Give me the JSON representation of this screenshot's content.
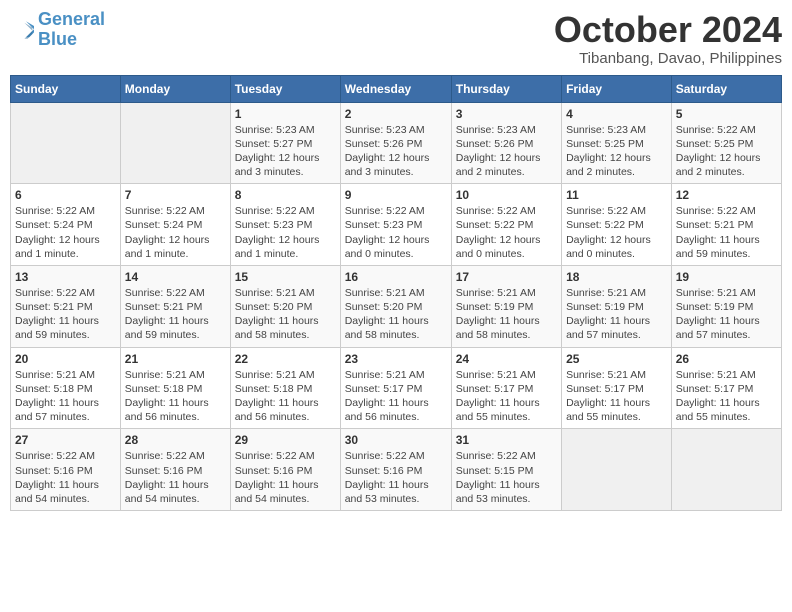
{
  "logo": {
    "line1": "General",
    "line2": "Blue"
  },
  "title": "October 2024",
  "subtitle": "Tibanbang, Davao, Philippines",
  "weekdays": [
    "Sunday",
    "Monday",
    "Tuesday",
    "Wednesday",
    "Thursday",
    "Friday",
    "Saturday"
  ],
  "weeks": [
    [
      {
        "day": "",
        "info": ""
      },
      {
        "day": "",
        "info": ""
      },
      {
        "day": "1",
        "info": "Sunrise: 5:23 AM\nSunset: 5:27 PM\nDaylight: 12 hours\nand 3 minutes."
      },
      {
        "day": "2",
        "info": "Sunrise: 5:23 AM\nSunset: 5:26 PM\nDaylight: 12 hours\nand 3 minutes."
      },
      {
        "day": "3",
        "info": "Sunrise: 5:23 AM\nSunset: 5:26 PM\nDaylight: 12 hours\nand 2 minutes."
      },
      {
        "day": "4",
        "info": "Sunrise: 5:23 AM\nSunset: 5:25 PM\nDaylight: 12 hours\nand 2 minutes."
      },
      {
        "day": "5",
        "info": "Sunrise: 5:22 AM\nSunset: 5:25 PM\nDaylight: 12 hours\nand 2 minutes."
      }
    ],
    [
      {
        "day": "6",
        "info": "Sunrise: 5:22 AM\nSunset: 5:24 PM\nDaylight: 12 hours\nand 1 minute."
      },
      {
        "day": "7",
        "info": "Sunrise: 5:22 AM\nSunset: 5:24 PM\nDaylight: 12 hours\nand 1 minute."
      },
      {
        "day": "8",
        "info": "Sunrise: 5:22 AM\nSunset: 5:23 PM\nDaylight: 12 hours\nand 1 minute."
      },
      {
        "day": "9",
        "info": "Sunrise: 5:22 AM\nSunset: 5:23 PM\nDaylight: 12 hours\nand 0 minutes."
      },
      {
        "day": "10",
        "info": "Sunrise: 5:22 AM\nSunset: 5:22 PM\nDaylight: 12 hours\nand 0 minutes."
      },
      {
        "day": "11",
        "info": "Sunrise: 5:22 AM\nSunset: 5:22 PM\nDaylight: 12 hours\nand 0 minutes."
      },
      {
        "day": "12",
        "info": "Sunrise: 5:22 AM\nSunset: 5:21 PM\nDaylight: 11 hours\nand 59 minutes."
      }
    ],
    [
      {
        "day": "13",
        "info": "Sunrise: 5:22 AM\nSunset: 5:21 PM\nDaylight: 11 hours\nand 59 minutes."
      },
      {
        "day": "14",
        "info": "Sunrise: 5:22 AM\nSunset: 5:21 PM\nDaylight: 11 hours\nand 59 minutes."
      },
      {
        "day": "15",
        "info": "Sunrise: 5:21 AM\nSunset: 5:20 PM\nDaylight: 11 hours\nand 58 minutes."
      },
      {
        "day": "16",
        "info": "Sunrise: 5:21 AM\nSunset: 5:20 PM\nDaylight: 11 hours\nand 58 minutes."
      },
      {
        "day": "17",
        "info": "Sunrise: 5:21 AM\nSunset: 5:19 PM\nDaylight: 11 hours\nand 58 minutes."
      },
      {
        "day": "18",
        "info": "Sunrise: 5:21 AM\nSunset: 5:19 PM\nDaylight: 11 hours\nand 57 minutes."
      },
      {
        "day": "19",
        "info": "Sunrise: 5:21 AM\nSunset: 5:19 PM\nDaylight: 11 hours\nand 57 minutes."
      }
    ],
    [
      {
        "day": "20",
        "info": "Sunrise: 5:21 AM\nSunset: 5:18 PM\nDaylight: 11 hours\nand 57 minutes."
      },
      {
        "day": "21",
        "info": "Sunrise: 5:21 AM\nSunset: 5:18 PM\nDaylight: 11 hours\nand 56 minutes."
      },
      {
        "day": "22",
        "info": "Sunrise: 5:21 AM\nSunset: 5:18 PM\nDaylight: 11 hours\nand 56 minutes."
      },
      {
        "day": "23",
        "info": "Sunrise: 5:21 AM\nSunset: 5:17 PM\nDaylight: 11 hours\nand 56 minutes."
      },
      {
        "day": "24",
        "info": "Sunrise: 5:21 AM\nSunset: 5:17 PM\nDaylight: 11 hours\nand 55 minutes."
      },
      {
        "day": "25",
        "info": "Sunrise: 5:21 AM\nSunset: 5:17 PM\nDaylight: 11 hours\nand 55 minutes."
      },
      {
        "day": "26",
        "info": "Sunrise: 5:21 AM\nSunset: 5:17 PM\nDaylight: 11 hours\nand 55 minutes."
      }
    ],
    [
      {
        "day": "27",
        "info": "Sunrise: 5:22 AM\nSunset: 5:16 PM\nDaylight: 11 hours\nand 54 minutes."
      },
      {
        "day": "28",
        "info": "Sunrise: 5:22 AM\nSunset: 5:16 PM\nDaylight: 11 hours\nand 54 minutes."
      },
      {
        "day": "29",
        "info": "Sunrise: 5:22 AM\nSunset: 5:16 PM\nDaylight: 11 hours\nand 54 minutes."
      },
      {
        "day": "30",
        "info": "Sunrise: 5:22 AM\nSunset: 5:16 PM\nDaylight: 11 hours\nand 53 minutes."
      },
      {
        "day": "31",
        "info": "Sunrise: 5:22 AM\nSunset: 5:15 PM\nDaylight: 11 hours\nand 53 minutes."
      },
      {
        "day": "",
        "info": ""
      },
      {
        "day": "",
        "info": ""
      }
    ]
  ]
}
